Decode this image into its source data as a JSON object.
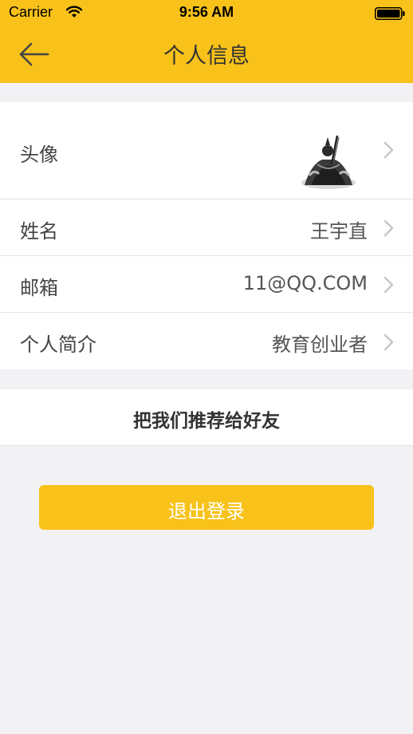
{
  "status_bar": {
    "carrier": "Carrier",
    "time": "9:56 AM",
    "wifi_icon": "wifi-icon",
    "battery_icon": "battery-full-icon"
  },
  "nav": {
    "back_icon": "arrow-left-icon",
    "title": "个人信息",
    "bar_color": "#f8c21a"
  },
  "profile": {
    "avatar": {
      "label": "头像",
      "image": "avatar-ink-painting-figure"
    },
    "name": {
      "label": "姓名",
      "value": "王宇直"
    },
    "email": {
      "label": "邮箱",
      "value": "11@QQ.COM"
    },
    "bio": {
      "label": "个人简介",
      "value": "教育创业者"
    },
    "row_icon": "chevron-right-icon"
  },
  "share": {
    "label": "把我们推荐给好友"
  },
  "logout": {
    "label": "退出登录",
    "color": "#f8c21a"
  }
}
